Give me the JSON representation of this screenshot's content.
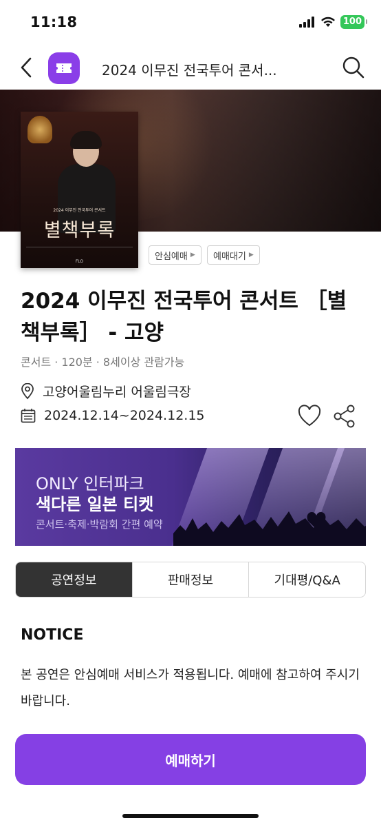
{
  "status_bar": {
    "time": "11:18",
    "battery": "100"
  },
  "header": {
    "title": "2024 이무진 전국투어 콘서..."
  },
  "poster": {
    "subtitle": "2024 이무진 전국투어 콘서트",
    "title": "별책부록",
    "brand": "FLO"
  },
  "chips": [
    {
      "label": "안심예매"
    },
    {
      "label": "예매대기"
    }
  ],
  "event": {
    "title": "2024 이무진 전국투어 콘서트 ［별책부록］ - 고양",
    "meta": "콘서트 · 120분 · 8세이상 관람가능",
    "venue": "고양어울림누리 어울림극장",
    "dates": "2024.12.14~2024.12.15"
  },
  "banner": {
    "line1": "ONLY 인터파크",
    "line2": "색다른 일본 티켓",
    "line3": "콘서트·축제·박람회 간편 예약"
  },
  "tabs": [
    {
      "label": "공연정보",
      "active": true
    },
    {
      "label": "판매정보",
      "active": false
    },
    {
      "label": "기대평/Q&A",
      "active": false
    }
  ],
  "notice": {
    "title": "NOTICE",
    "body": "본 공연은 안심예매 서비스가 적용됩니다. 예매에 참고하여 주시기 바랍니다."
  },
  "cta": {
    "label": "예매하기"
  },
  "colors": {
    "accent": "#8540e4",
    "tab_active": "#333333",
    "battery": "#34c759"
  }
}
